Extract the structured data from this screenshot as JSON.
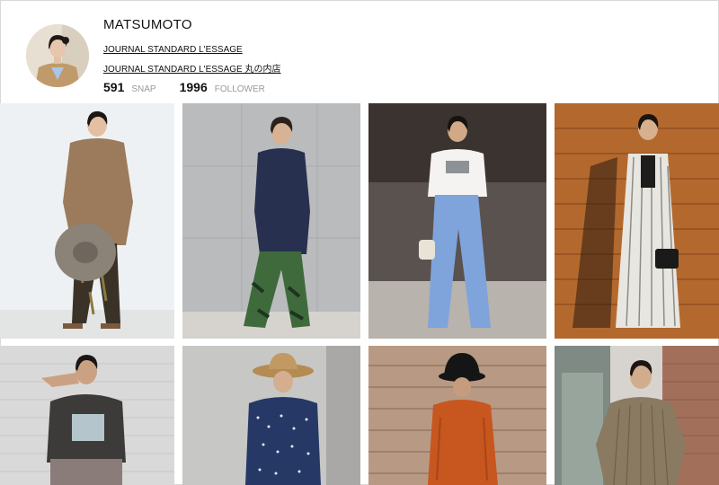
{
  "profile": {
    "name": "MATSUMOTO",
    "shop_links": [
      "JOURNAL STANDARD L'ESSAGE",
      "JOURNAL STANDARD L'ESSAGE 丸の内店"
    ],
    "snap_count": "591",
    "snap_label": "SNAP",
    "follower_count": "1996",
    "follower_label": "FOLLOWER"
  },
  "photos": [
    {
      "icon": "snap-photo-brown-tunic-hat"
    },
    {
      "icon": "snap-photo-navy-shirt-green-pants"
    },
    {
      "icon": "snap-photo-white-tee-blue-jeans"
    },
    {
      "icon": "snap-photo-striped-dress"
    },
    {
      "icon": "snap-photo-grey-graphic-tee"
    },
    {
      "icon": "snap-photo-navy-dot-dress-straw-hat"
    },
    {
      "icon": "snap-photo-orange-dress-black-hat"
    },
    {
      "icon": "snap-photo-khaki-shirt-dress"
    }
  ],
  "colors": {
    "link": "#111111",
    "stat_label": "#9a9a9a",
    "border": "#d9d9d9"
  }
}
